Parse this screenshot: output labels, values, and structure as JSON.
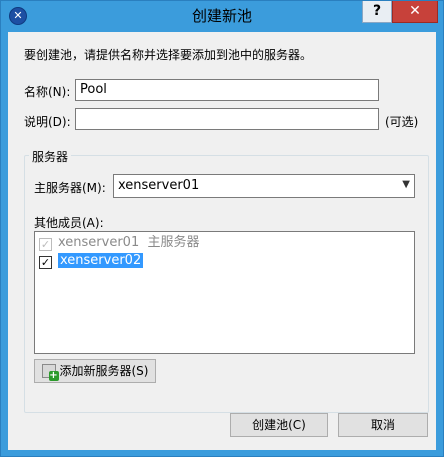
{
  "window": {
    "title": "创建新池",
    "help_label": "?",
    "close_label": "✕",
    "app_icon": "✕"
  },
  "intro": "要创建池，请提供名称并选择要添加到池中的服务器。",
  "form": {
    "name_label": "名称(N):",
    "name_value": "Pool",
    "desc_label": "说明(D):",
    "desc_value": "",
    "optional_label": "(可选)"
  },
  "servers": {
    "group_title": "服务器",
    "master_label": "主服务器(M):",
    "master_value": "xenserver01",
    "members_label": "其他成员(A):",
    "members": [
      {
        "name": "xenserver01",
        "note": "主服务器",
        "checked": true,
        "disabled": true
      },
      {
        "name": "xenserver02",
        "note": "",
        "checked": true,
        "disabled": false,
        "selected": true
      }
    ],
    "add_button": "添加新服务器(S)"
  },
  "footer": {
    "create_button": "创建池(C)",
    "cancel_button": "取消"
  },
  "colors": {
    "titlebar": "#3b9cdc",
    "selection": "#3399ff",
    "close": "#c7413a"
  }
}
